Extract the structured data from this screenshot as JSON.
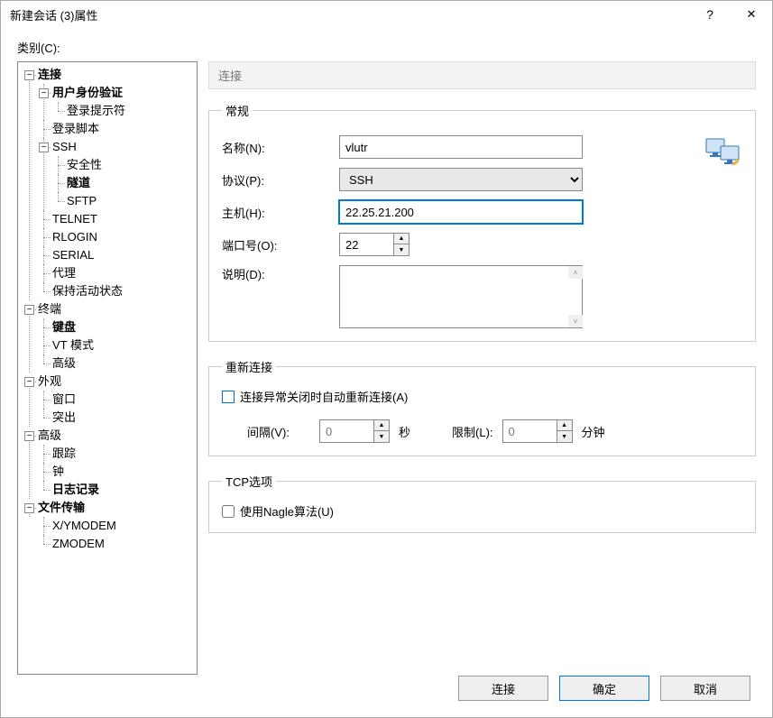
{
  "window": {
    "title": "新建会话 (3)属性",
    "help": "?",
    "close": "✕"
  },
  "category_label": "类别(C):",
  "tree": {
    "connection": "连接",
    "auth": "用户身份验证",
    "login_prompt": "登录提示符",
    "login_script": "登录脚本",
    "ssh": "SSH",
    "security": "安全性",
    "tunnel": "隧道",
    "sftp": "SFTP",
    "telnet": "TELNET",
    "rlogin": "RLOGIN",
    "serial": "SERIAL",
    "proxy": "代理",
    "keepalive": "保持活动状态",
    "terminal": "终端",
    "keyboard": "键盘",
    "vt": "VT 模式",
    "adv_term": "高级",
    "appearance": "外观",
    "window": "窗口",
    "highlight": "突出",
    "advanced": "高级",
    "trace": "跟踪",
    "bell": "钟",
    "logging": "日志记录",
    "filetransfer": "文件传输",
    "xymodem": "X/YMODEM",
    "zmodem": "ZMODEM"
  },
  "panel": {
    "header": "连接",
    "group_general": "常规",
    "name_label": "名称(N):",
    "name_value": "vlutr",
    "proto_label": "协议(P):",
    "proto_value": "SSH",
    "host_label": "主机(H):",
    "host_value": "22.25.21.200",
    "port_label": "端口号(O):",
    "port_value": "22",
    "desc_label": "说明(D):",
    "desc_value": "",
    "group_reconnect": "重新连接",
    "reconnect_chk": "连接异常关闭时自动重新连接(A)",
    "interval_label": "间隔(V):",
    "interval_value": "0",
    "sec": "秒",
    "limit_label": "限制(L):",
    "limit_value": "0",
    "min": "分钟",
    "group_tcp": "TCP选项",
    "nagle_chk": "使用Nagle算法(U)"
  },
  "footer": {
    "connect": "连接",
    "ok": "确定",
    "cancel": "取消"
  }
}
